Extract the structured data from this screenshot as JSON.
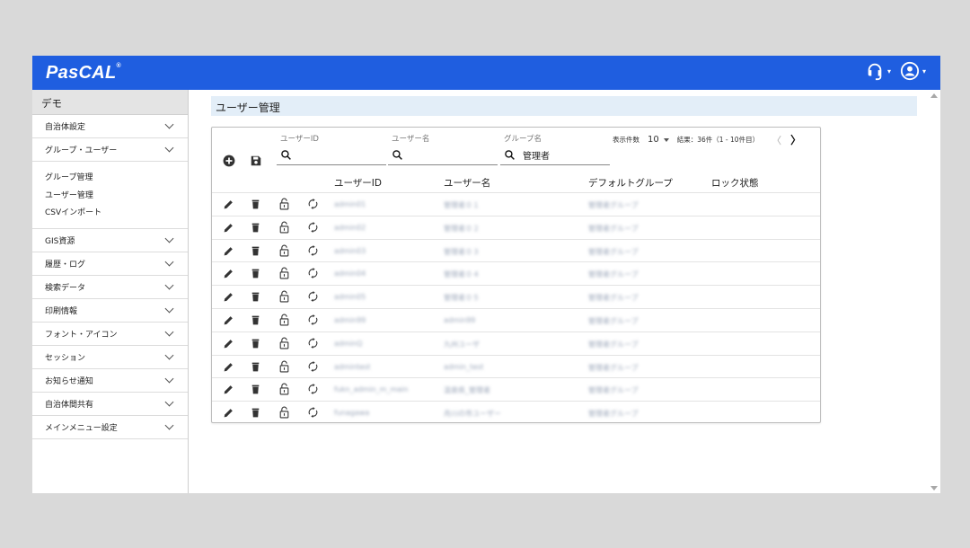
{
  "app": {
    "logo": "PasCAL",
    "logo_mark": "®"
  },
  "sidebar": {
    "header": "デモ",
    "groups_before": [
      {
        "label": "自治体設定"
      },
      {
        "label": "グループ・ユーザー"
      }
    ],
    "sub_items": [
      "グループ管理",
      "ユーザー管理",
      "CSVインポート"
    ],
    "groups_after": [
      {
        "label": "GIS資源"
      },
      {
        "label": "履歴・ログ"
      },
      {
        "label": "検索データ"
      },
      {
        "label": "印刷情報"
      },
      {
        "label": "フォント・アイコン"
      },
      {
        "label": "セッション"
      },
      {
        "label": "お知らせ通知"
      },
      {
        "label": "自治体間共有"
      },
      {
        "label": "メインメニュー設定"
      }
    ]
  },
  "main": {
    "title": "ユーザー管理",
    "filters": {
      "user_id": {
        "label": "ユーザーID",
        "value": ""
      },
      "user_name": {
        "label": "ユーザー名",
        "value": ""
      },
      "group_name": {
        "label": "グループ名",
        "value": "管理者"
      }
    },
    "pager": {
      "per_page_label": "表示件数",
      "per_page": "10",
      "result": "結果：36件（1 - 10件目）",
      "prev": "〈",
      "next": "〉"
    },
    "table": {
      "columns": [
        "ユーザーID",
        "ユーザー名",
        "デフォルトグループ",
        "ロック状態"
      ],
      "rows": [
        {
          "id": "admin01",
          "name": "管理者０１",
          "group": "管理者グループ",
          "lock": ""
        },
        {
          "id": "admin02",
          "name": "管理者０２",
          "group": "管理者グループ",
          "lock": ""
        },
        {
          "id": "admin03",
          "name": "管理者０３",
          "group": "管理者グループ",
          "lock": ""
        },
        {
          "id": "admin04",
          "name": "管理者０４",
          "group": "管理者グループ",
          "lock": ""
        },
        {
          "id": "admin05",
          "name": "管理者０５",
          "group": "管理者グループ",
          "lock": ""
        },
        {
          "id": "admin99",
          "name": "admin99",
          "group": "管理者グループ",
          "lock": ""
        },
        {
          "id": "adminQ",
          "name": "九州ユーザ",
          "group": "管理者グループ",
          "lock": ""
        },
        {
          "id": "admintest",
          "name": "admin_test",
          "group": "管理者グループ",
          "lock": ""
        },
        {
          "id": "fukn_admin_m_main",
          "name": "温泉県_管理者",
          "group": "管理者グループ",
          "lock": ""
        },
        {
          "id": "funagawa",
          "name": "舟川の市ユーザー",
          "group": "管理者グループ",
          "lock": ""
        }
      ]
    }
  },
  "colors": {
    "header_blue": "#1f5ee0",
    "title_bg": "#e3eef8"
  },
  "icons": [
    "headset-icon",
    "account-icon",
    "add-circle-icon",
    "save-icon",
    "search-icon",
    "edit-icon",
    "delete-icon",
    "lock-icon",
    "refresh-icon"
  ]
}
